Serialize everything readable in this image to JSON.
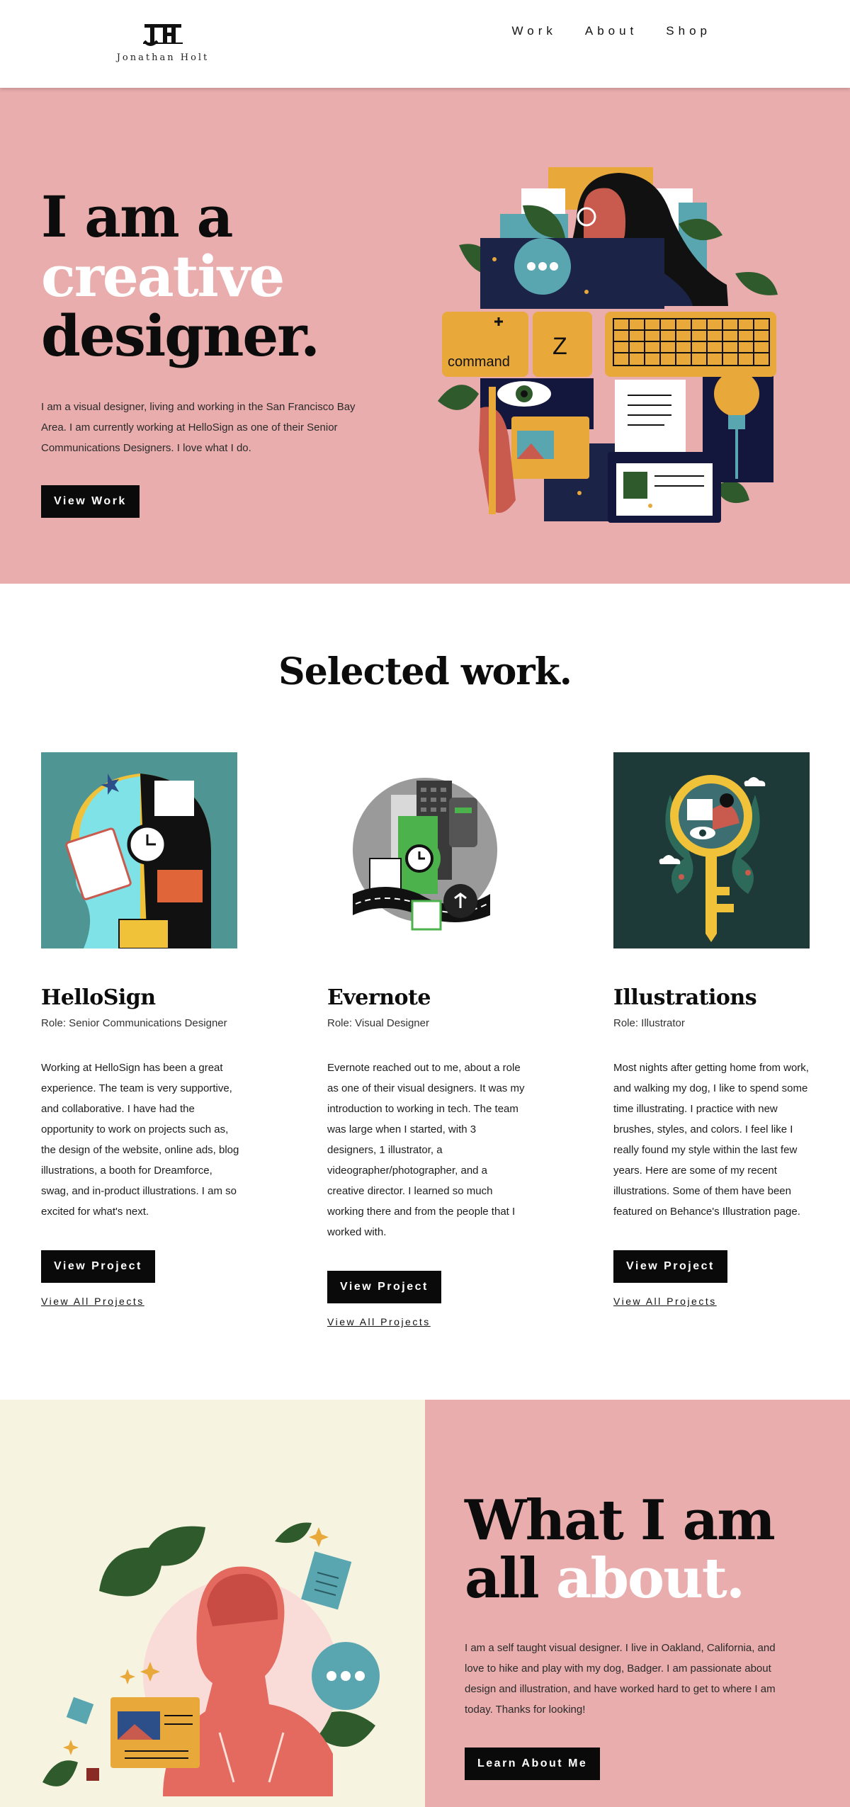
{
  "header": {
    "logo_name": "Jonathan Holt",
    "nav": [
      {
        "label": "Work"
      },
      {
        "label": "About"
      },
      {
        "label": "Shop"
      }
    ]
  },
  "hero": {
    "title_line1": "I am a",
    "title_line2": "creative",
    "title_line3": "designer.",
    "description": "I am a visual designer, living and working in the San Francisco Bay Area. I am currently working at HelloSign as one of their Senior Communications Designers. I love what I do.",
    "button_label": "View Work",
    "art_key_command": "command",
    "art_key_z": "Z"
  },
  "work": {
    "title": "Selected work.",
    "cards": [
      {
        "title": "HelloSign",
        "role": "Role: Senior Communications Designer",
        "description": "Working at HelloSign has been a great experience. The team is very supportive, and collaborative. I have had the opportunity to work on projects such as, the design of the website, online ads, blog illustrations, a booth for Dreamforce, swag, and in-product illustrations. I am so excited for what's next.",
        "button_label": "View Project",
        "link_label": "View All Projects"
      },
      {
        "title": "Evernote",
        "role": "Role: Visual Designer",
        "description": "Evernote reached out to me, about a role as one of their visual designers. It was my introduction to working in tech. The team was large when I started, with 3 designers, 1 illustrator, a videographer/photographer, and a creative director. I learned so much working there and from the people that I worked with.",
        "button_label": "View Project",
        "link_label": "View All Projects"
      },
      {
        "title": "Illustrations",
        "role": "Role: Illustrator",
        "description": "Most nights after getting home from work, and walking my dog, I like to spend some time illustrating. I practice with new brushes, styles, and colors. I feel like I really found my style within the last few years. Here are some of my recent illustrations. Some of them have been featured on Behance's Illustration page.",
        "button_label": "View Project",
        "link_label": "View All Projects"
      }
    ]
  },
  "about": {
    "title_line1": "What I am",
    "title_line2_a": "all",
    "title_line2_b": "about.",
    "description": "I am a self taught visual designer. I live in Oakland, California, and love to hike and play with my dog, Badger. I am passionate about design and illustration, and have worked hard to get to where I am today. Thanks for looking!",
    "button_label": "Learn About Me"
  },
  "colors": {
    "pink": "#e9adad",
    "cream": "#f6f4e1",
    "teal": "#4f9594",
    "dark_teal": "#1e3a38",
    "black": "#0a0a0a",
    "yellow": "#e8a83a"
  }
}
